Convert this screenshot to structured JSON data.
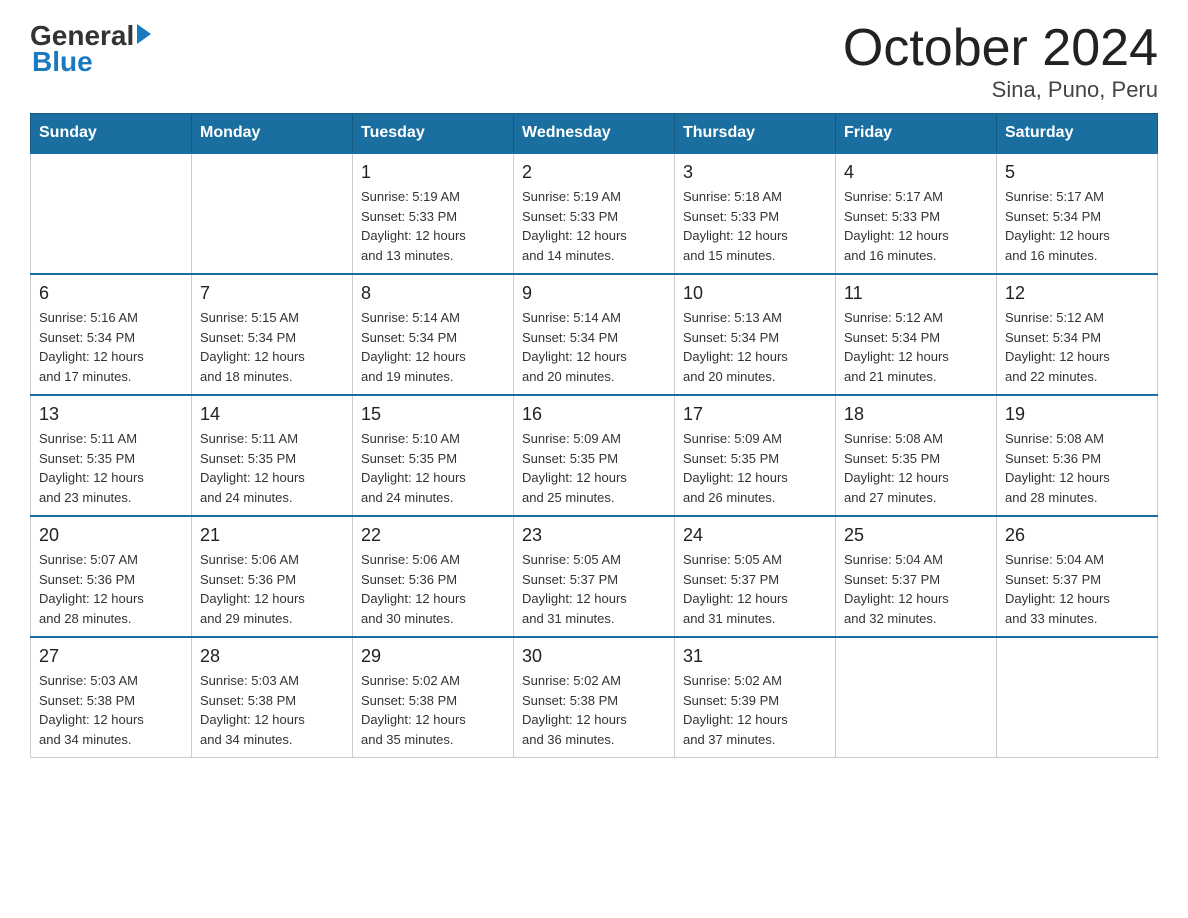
{
  "logo": {
    "general": "General",
    "blue": "Blue"
  },
  "title": "October 2024",
  "subtitle": "Sina, Puno, Peru",
  "days_of_week": [
    "Sunday",
    "Monday",
    "Tuesday",
    "Wednesday",
    "Thursday",
    "Friday",
    "Saturday"
  ],
  "weeks": [
    [
      {
        "day": "",
        "info": ""
      },
      {
        "day": "",
        "info": ""
      },
      {
        "day": "1",
        "info": "Sunrise: 5:19 AM\nSunset: 5:33 PM\nDaylight: 12 hours\nand 13 minutes."
      },
      {
        "day": "2",
        "info": "Sunrise: 5:19 AM\nSunset: 5:33 PM\nDaylight: 12 hours\nand 14 minutes."
      },
      {
        "day": "3",
        "info": "Sunrise: 5:18 AM\nSunset: 5:33 PM\nDaylight: 12 hours\nand 15 minutes."
      },
      {
        "day": "4",
        "info": "Sunrise: 5:17 AM\nSunset: 5:33 PM\nDaylight: 12 hours\nand 16 minutes."
      },
      {
        "day": "5",
        "info": "Sunrise: 5:17 AM\nSunset: 5:34 PM\nDaylight: 12 hours\nand 16 minutes."
      }
    ],
    [
      {
        "day": "6",
        "info": "Sunrise: 5:16 AM\nSunset: 5:34 PM\nDaylight: 12 hours\nand 17 minutes."
      },
      {
        "day": "7",
        "info": "Sunrise: 5:15 AM\nSunset: 5:34 PM\nDaylight: 12 hours\nand 18 minutes."
      },
      {
        "day": "8",
        "info": "Sunrise: 5:14 AM\nSunset: 5:34 PM\nDaylight: 12 hours\nand 19 minutes."
      },
      {
        "day": "9",
        "info": "Sunrise: 5:14 AM\nSunset: 5:34 PM\nDaylight: 12 hours\nand 20 minutes."
      },
      {
        "day": "10",
        "info": "Sunrise: 5:13 AM\nSunset: 5:34 PM\nDaylight: 12 hours\nand 20 minutes."
      },
      {
        "day": "11",
        "info": "Sunrise: 5:12 AM\nSunset: 5:34 PM\nDaylight: 12 hours\nand 21 minutes."
      },
      {
        "day": "12",
        "info": "Sunrise: 5:12 AM\nSunset: 5:34 PM\nDaylight: 12 hours\nand 22 minutes."
      }
    ],
    [
      {
        "day": "13",
        "info": "Sunrise: 5:11 AM\nSunset: 5:35 PM\nDaylight: 12 hours\nand 23 minutes."
      },
      {
        "day": "14",
        "info": "Sunrise: 5:11 AM\nSunset: 5:35 PM\nDaylight: 12 hours\nand 24 minutes."
      },
      {
        "day": "15",
        "info": "Sunrise: 5:10 AM\nSunset: 5:35 PM\nDaylight: 12 hours\nand 24 minutes."
      },
      {
        "day": "16",
        "info": "Sunrise: 5:09 AM\nSunset: 5:35 PM\nDaylight: 12 hours\nand 25 minutes."
      },
      {
        "day": "17",
        "info": "Sunrise: 5:09 AM\nSunset: 5:35 PM\nDaylight: 12 hours\nand 26 minutes."
      },
      {
        "day": "18",
        "info": "Sunrise: 5:08 AM\nSunset: 5:35 PM\nDaylight: 12 hours\nand 27 minutes."
      },
      {
        "day": "19",
        "info": "Sunrise: 5:08 AM\nSunset: 5:36 PM\nDaylight: 12 hours\nand 28 minutes."
      }
    ],
    [
      {
        "day": "20",
        "info": "Sunrise: 5:07 AM\nSunset: 5:36 PM\nDaylight: 12 hours\nand 28 minutes."
      },
      {
        "day": "21",
        "info": "Sunrise: 5:06 AM\nSunset: 5:36 PM\nDaylight: 12 hours\nand 29 minutes."
      },
      {
        "day": "22",
        "info": "Sunrise: 5:06 AM\nSunset: 5:36 PM\nDaylight: 12 hours\nand 30 minutes."
      },
      {
        "day": "23",
        "info": "Sunrise: 5:05 AM\nSunset: 5:37 PM\nDaylight: 12 hours\nand 31 minutes."
      },
      {
        "day": "24",
        "info": "Sunrise: 5:05 AM\nSunset: 5:37 PM\nDaylight: 12 hours\nand 31 minutes."
      },
      {
        "day": "25",
        "info": "Sunrise: 5:04 AM\nSunset: 5:37 PM\nDaylight: 12 hours\nand 32 minutes."
      },
      {
        "day": "26",
        "info": "Sunrise: 5:04 AM\nSunset: 5:37 PM\nDaylight: 12 hours\nand 33 minutes."
      }
    ],
    [
      {
        "day": "27",
        "info": "Sunrise: 5:03 AM\nSunset: 5:38 PM\nDaylight: 12 hours\nand 34 minutes."
      },
      {
        "day": "28",
        "info": "Sunrise: 5:03 AM\nSunset: 5:38 PM\nDaylight: 12 hours\nand 34 minutes."
      },
      {
        "day": "29",
        "info": "Sunrise: 5:02 AM\nSunset: 5:38 PM\nDaylight: 12 hours\nand 35 minutes."
      },
      {
        "day": "30",
        "info": "Sunrise: 5:02 AM\nSunset: 5:38 PM\nDaylight: 12 hours\nand 36 minutes."
      },
      {
        "day": "31",
        "info": "Sunrise: 5:02 AM\nSunset: 5:39 PM\nDaylight: 12 hours\nand 37 minutes."
      },
      {
        "day": "",
        "info": ""
      },
      {
        "day": "",
        "info": ""
      }
    ]
  ]
}
